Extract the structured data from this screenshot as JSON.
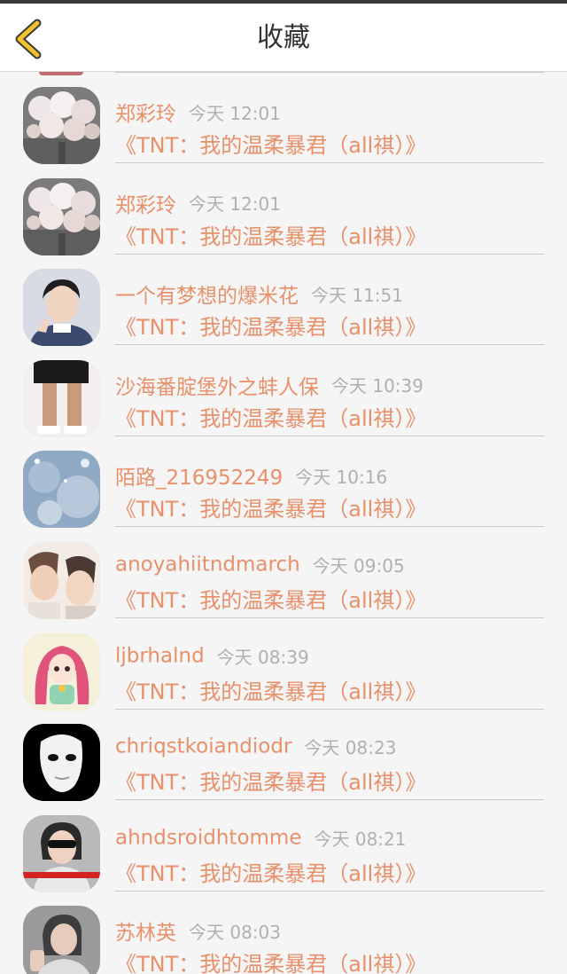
{
  "header": {
    "title": "收藏",
    "back_icon": "chevron-left-icon",
    "accent": "#f2c12e"
  },
  "colors": {
    "name": "#e8906a",
    "time": "#b0b0b0",
    "work": "#e8906a",
    "divider": "#c8c8c8"
  },
  "items": [
    {
      "name": "郑彩玲",
      "time": "今天 12:01",
      "work": "《TNT：我的温柔暴君（all祺）》",
      "avatar": "bouquet-avatar"
    },
    {
      "name": "郑彩玲",
      "time": "今天 12:01",
      "work": "《TNT：我的温柔暴君（all祺）》",
      "avatar": "bouquet-avatar"
    },
    {
      "name": "一个有梦想的爆米花",
      "time": "今天 11:51",
      "work": "《TNT：我的温柔暴君（all祺）》",
      "avatar": "boy-avatar"
    },
    {
      "name": "沙海番腚堡外之蚌人保",
      "time": "今天 10:39",
      "work": "《TNT：我的温柔暴君（all祺）》",
      "avatar": "legs-avatar"
    },
    {
      "name": "陌路_216952249",
      "time": "今天 10:16",
      "work": "《TNT：我的温柔暴君（all祺）》",
      "avatar": "sky-avatar"
    },
    {
      "name": "anoyahiitndmarch",
      "time": "今天 09:05",
      "work": "《TNT：我的温柔暴君（all祺）》",
      "avatar": "couple-avatar"
    },
    {
      "name": "ljbrhalnd",
      "time": "今天 08:39",
      "work": "《TNT：我的温柔暴君（all祺）》",
      "avatar": "anime-girl-avatar"
    },
    {
      "name": "chriqstkoiandiodr",
      "time": "今天 08:23",
      "work": "《TNT：我的温柔暴君（all祺）》",
      "avatar": "mask-avatar"
    },
    {
      "name": "ahndsroidhtomme",
      "time": "今天 08:21",
      "work": "《TNT：我的温柔暴君（all祺）》",
      "avatar": "sunglasses-avatar"
    },
    {
      "name": "苏林英",
      "time": "今天 08:03",
      "work": "《TNT：我的温柔暴君（all祺）》",
      "avatar": "selfie-avatar"
    }
  ]
}
